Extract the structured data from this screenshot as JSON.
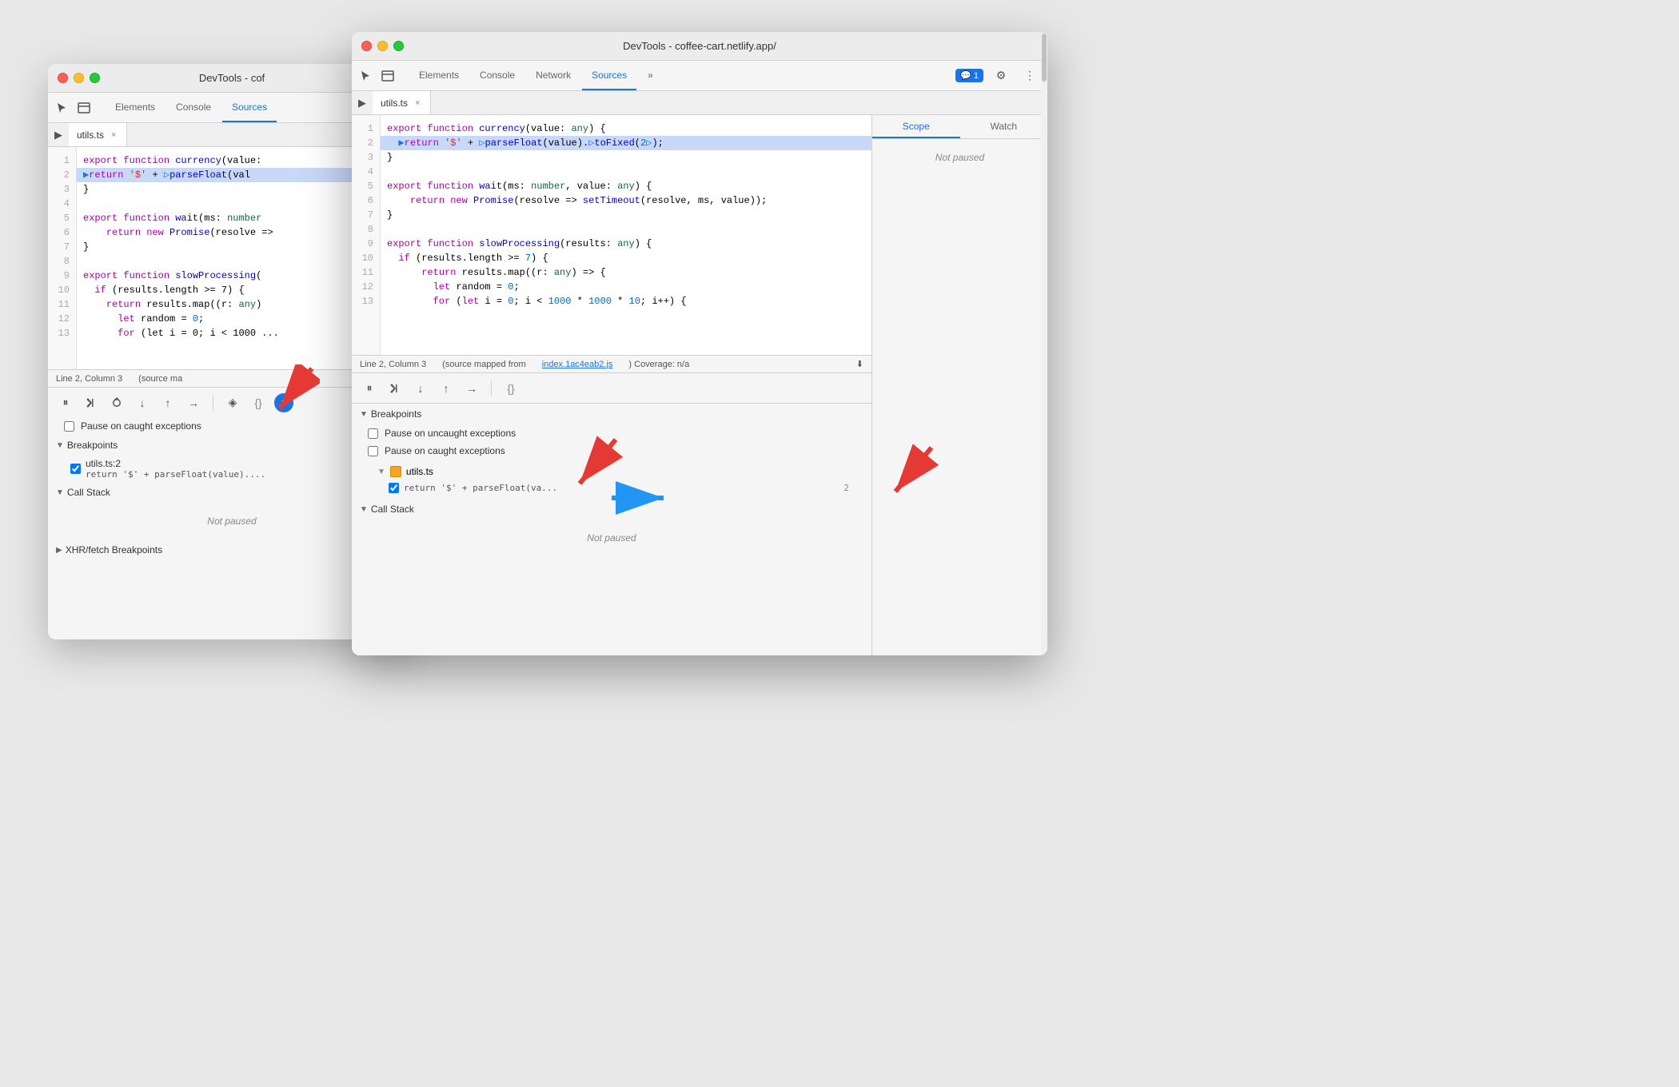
{
  "back_window": {
    "title": "DevTools - cof",
    "tabs": [
      "Elements",
      "Console",
      "Sources"
    ],
    "active_tab": "Sources",
    "file_tab": "utils.ts",
    "status": "Line 2, Column 3",
    "status_right": "(source ma",
    "code_lines": [
      {
        "num": 1,
        "text": "export function currency(value: ",
        "highlighted": false
      },
      {
        "num": 2,
        "text": "  ▶return '$' + ▷parseFloat(val",
        "highlighted": true
      },
      {
        "num": 3,
        "text": "}",
        "highlighted": false
      },
      {
        "num": 4,
        "text": "",
        "highlighted": false
      },
      {
        "num": 5,
        "text": "export function wait(ms: number",
        "highlighted": false
      },
      {
        "num": 6,
        "text": "    return new Promise(resolve =>",
        "highlighted": false
      },
      {
        "num": 7,
        "text": "}",
        "highlighted": false
      },
      {
        "num": 8,
        "text": "",
        "highlighted": false
      },
      {
        "num": 9,
        "text": "export function slowProcessing(",
        "highlighted": false
      },
      {
        "num": 10,
        "text": "  if (results.length >= 7) {",
        "highlighted": false
      },
      {
        "num": 11,
        "text": "    return results.map((r: any)",
        "highlighted": false
      },
      {
        "num": 12,
        "text": "      let random = 0;",
        "highlighted": false
      },
      {
        "num": 13,
        "text": "      for (let i = 0; i < 1000 ...",
        "highlighted": false
      }
    ],
    "debug_toolbar": {
      "pause_label": "⏸",
      "resume_label": "↩",
      "step_over_label": "↓",
      "step_into_label": "↑",
      "step_out_label": "→",
      "deactivate_label": "◉",
      "format_label": "{}"
    },
    "bottom_sections": {
      "pause_caught": "Pause on caught exceptions",
      "breakpoints_label": "Breakpoints",
      "breakpoints": [
        {
          "file": "utils.ts:2",
          "code": "return '$' + parseFloat(value)..."
        }
      ],
      "call_stack_label": "Call Stack",
      "not_paused": "Not paused",
      "xhr_label": "XHR/fetch Breakpoints"
    }
  },
  "front_window": {
    "title": "DevTools - coffee-cart.netlify.app/",
    "tabs": [
      "Elements",
      "Console",
      "Network",
      "Sources"
    ],
    "active_tab": "Sources",
    "file_tab": "utils.ts",
    "status": "Line 2, Column 3",
    "status_source": "(source mapped from ",
    "status_link": "index.1ac4eab2.js",
    "status_coverage": ") Coverage: n/a",
    "code_lines": [
      {
        "num": 1,
        "content_type": "normal",
        "text": "export function currency(value: any) {"
      },
      {
        "num": 2,
        "content_type": "highlighted",
        "text": "  ▶return '$' + ▷parseFloat(value).▷toFixed(2▷);"
      },
      {
        "num": 3,
        "content_type": "normal",
        "text": "}"
      },
      {
        "num": 4,
        "content_type": "normal",
        "text": ""
      },
      {
        "num": 5,
        "content_type": "normal",
        "text": "export function wait(ms: number, value: any) {"
      },
      {
        "num": 6,
        "content_type": "normal",
        "text": "    return new Promise(resolve => setTimeout(resolve, ms, value));"
      },
      {
        "num": 7,
        "content_type": "normal",
        "text": "}"
      },
      {
        "num": 8,
        "content_type": "normal",
        "text": ""
      },
      {
        "num": 9,
        "content_type": "normal",
        "text": "export function slowProcessing(results: any) {"
      },
      {
        "num": 10,
        "content_type": "normal",
        "text": "  if (results.length >= 7) {"
      },
      {
        "num": 11,
        "content_type": "normal",
        "text": "      return results.map((r: any) => {"
      },
      {
        "num": 12,
        "content_type": "normal",
        "text": "        let random = 0;"
      },
      {
        "num": 13,
        "content_type": "normal",
        "text": "        for (let i = 0; i < 1000 * 1000 * 10; i++) {"
      }
    ],
    "right_panel": {
      "scope_tab": "Scope",
      "watch_tab": "Watch",
      "not_paused": "Not paused"
    },
    "breakpoints_popup": {
      "title": "Breakpoints",
      "pause_uncaught": "Pause on uncaught exceptions",
      "pause_caught": "Pause on caught exceptions",
      "file": "utils.ts",
      "bp_code": "return '$' + parseFloat(va...",
      "bp_line": "2",
      "call_stack": "Call Stack",
      "not_paused": "Not paused"
    }
  },
  "arrows": {
    "blue_arrow": "→",
    "red_arrow1": "↙",
    "red_arrow2": "↙"
  }
}
